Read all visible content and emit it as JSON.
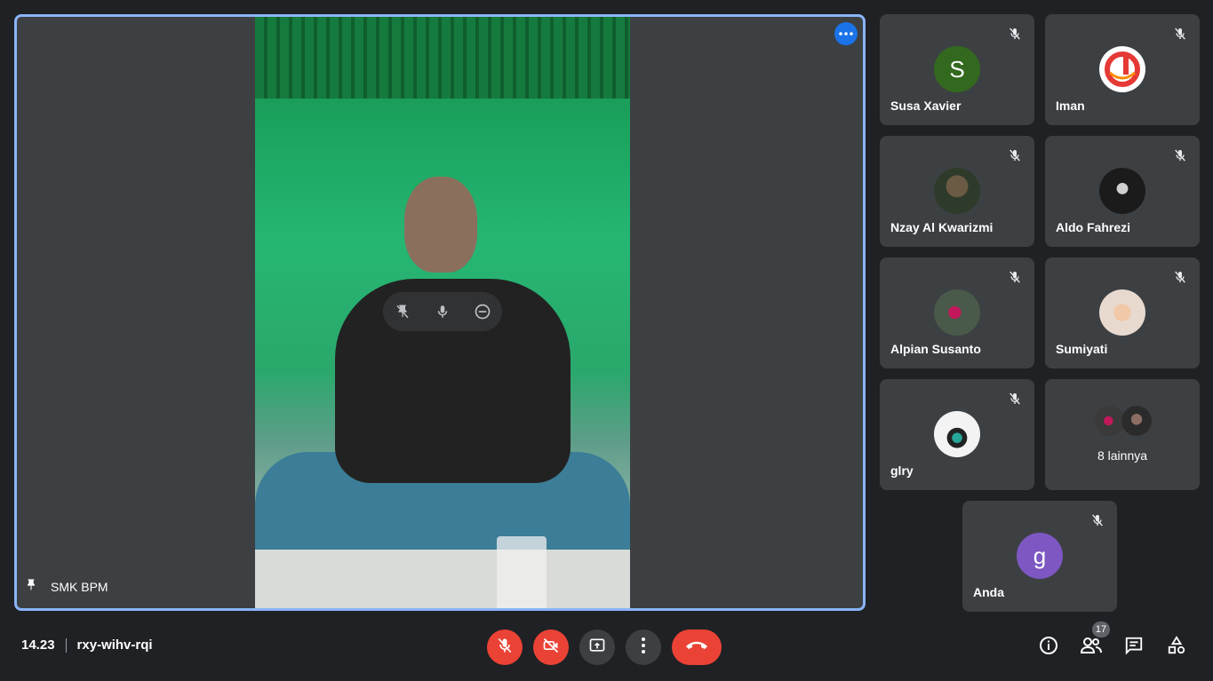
{
  "stage": {
    "participant_name": "SMK BPM"
  },
  "tiles": [
    {
      "name": "Susa Xavier",
      "avatar_letter": "S",
      "avatar_color": "#33691e"
    },
    {
      "name": "Iman",
      "avatar_letter": "",
      "avatar_color": "#ffffff"
    },
    {
      "name": "Nzay Al Kwarizmi",
      "avatar_letter": "",
      "avatar_color": "#2e3b2a"
    },
    {
      "name": "Aldo Fahrezi",
      "avatar_letter": "",
      "avatar_color": "#1b1b1b"
    },
    {
      "name": "Alpian Susanto",
      "avatar_letter": "",
      "avatar_color": "#4a5a4a"
    },
    {
      "name": "Sumiyati",
      "avatar_letter": "",
      "avatar_color": "#e8d9cf"
    },
    {
      "name": "glry",
      "avatar_letter": "",
      "avatar_color": "#f3f3f3"
    },
    {
      "name": "Anda",
      "avatar_letter": "g",
      "avatar_color": "#7e57c2"
    }
  ],
  "others_tile": {
    "label": "8 lainnya"
  },
  "bottom_bar": {
    "time": "14.23",
    "meeting_code": "rxy-wihv-rqi",
    "participant_count": "17"
  },
  "colors": {
    "accent_blue": "#8ab4f8",
    "danger_red": "#ea4335",
    "tile_bg": "#3c4043",
    "page_bg": "#202124"
  }
}
